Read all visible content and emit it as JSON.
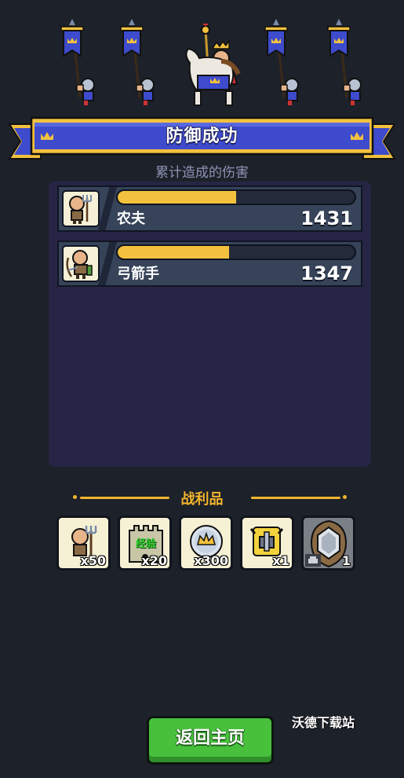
{
  "header": {
    "title": "防御成功",
    "subtitle": "累计造成的伤害"
  },
  "damage": {
    "units": [
      {
        "name": "农夫",
        "damage": "1431",
        "fill": 0.5,
        "icon": "farmer-icon"
      },
      {
        "name": "弓箭手",
        "damage": "1347",
        "fill": 0.47,
        "icon": "archer-icon"
      }
    ]
  },
  "loot": {
    "title": "战利品",
    "items": [
      {
        "icon": "farmer-icon",
        "count": "x50"
      },
      {
        "icon": "tower-exp-icon",
        "label": "经验",
        "count": "x20"
      },
      {
        "icon": "crown-coin-icon",
        "count": "x300"
      },
      {
        "icon": "helmet-icon",
        "count": "x1"
      },
      {
        "icon": "gem-shield-icon",
        "count": "1",
        "sub_icon": "chest-icon"
      }
    ]
  },
  "footer": {
    "home_button": "返回主页",
    "watermark": "沃德下载站"
  },
  "colors": {
    "background": "#1d2129",
    "panel": "#272545",
    "ribbon": "#3d4bcc",
    "gold": "#f3c13d",
    "button": "#48c03c"
  }
}
